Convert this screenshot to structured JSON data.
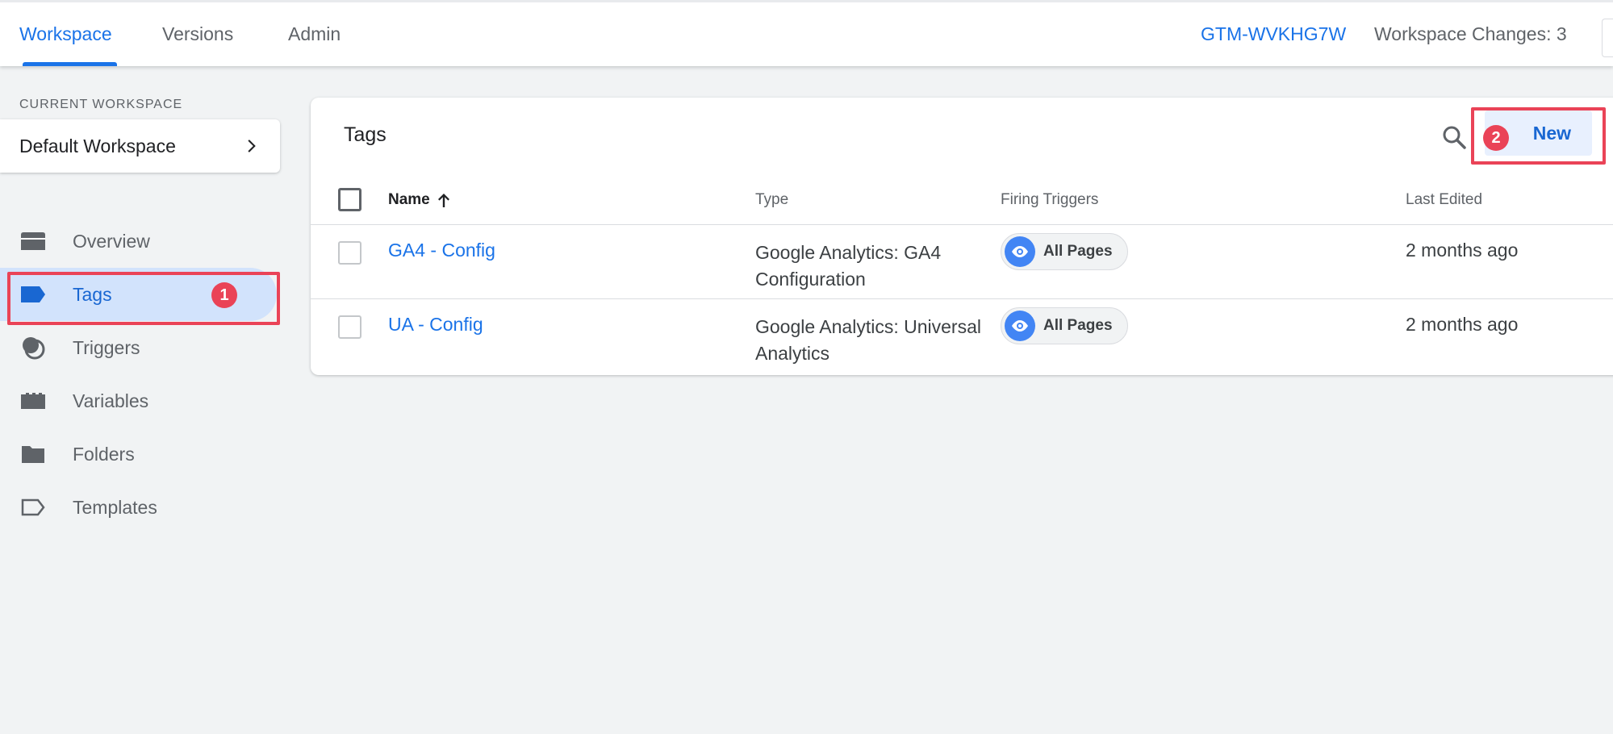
{
  "top_nav": {
    "tabs": [
      {
        "label": "Workspace",
        "active": true
      },
      {
        "label": "Versions",
        "active": false
      },
      {
        "label": "Admin",
        "active": false
      }
    ],
    "container_id": "GTM-WVKHG7W",
    "workspace_changes": "Workspace Changes: 3"
  },
  "sidebar": {
    "current_workspace_label": "CURRENT WORKSPACE",
    "workspace_name": "Default Workspace",
    "items": [
      {
        "label": "Overview",
        "icon": "overview-icon",
        "active": false
      },
      {
        "label": "Tags",
        "icon": "tag-icon",
        "active": true
      },
      {
        "label": "Triggers",
        "icon": "trigger-icon",
        "active": false
      },
      {
        "label": "Variables",
        "icon": "variables-icon",
        "active": false
      },
      {
        "label": "Folders",
        "icon": "folder-icon",
        "active": false
      },
      {
        "label": "Templates",
        "icon": "template-icon",
        "active": false
      }
    ]
  },
  "annotations": {
    "step1": "1",
    "step2": "2"
  },
  "main": {
    "title": "Tags",
    "new_button": "New",
    "columns": {
      "name": "Name",
      "type": "Type",
      "firing_triggers": "Firing Triggers",
      "last_edited": "Last Edited"
    },
    "rows": [
      {
        "name": "GA4 - Config",
        "type": "Google Analytics: GA4 Configuration",
        "trigger": "All Pages",
        "last_edited": "2 months ago"
      },
      {
        "name": "UA - Config",
        "type": "Google Analytics: Universal Analytics",
        "trigger": "All Pages",
        "last_edited": "2 months ago"
      }
    ]
  },
  "colors": {
    "accent": "#1a73e8",
    "active_nav_bg": "#d2e3fc",
    "annotation": "#ea4357",
    "background": "#f1f3f4"
  }
}
